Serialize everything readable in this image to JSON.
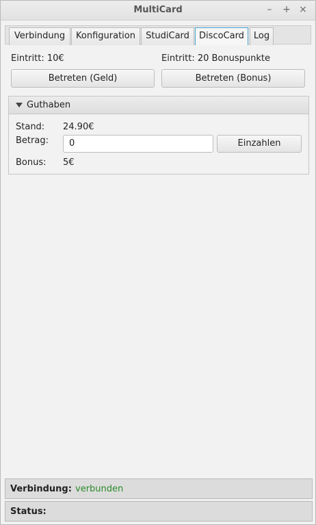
{
  "window": {
    "title": "MultiCard",
    "controls": {
      "minimize": "–",
      "maximize": "+",
      "close": "×"
    }
  },
  "tabs": [
    {
      "label": "Verbindung",
      "active": false
    },
    {
      "label": "Konfiguration",
      "active": false
    },
    {
      "label": "StudiCard",
      "active": false
    },
    {
      "label": "DiscoCard",
      "active": true
    },
    {
      "label": "Log",
      "active": false
    }
  ],
  "disco": {
    "entry_money_label": "Eintritt: 10€",
    "entry_bonus_label": "Eintritt: 20 Bonuspunkte",
    "enter_money_button": "Betreten (Geld)",
    "enter_bonus_button": "Betreten (Bonus)"
  },
  "balance_panel": {
    "title": "Guthaben",
    "stand_label": "Stand:",
    "stand_value": "24.90€",
    "betrag_label": "Betrag:",
    "betrag_value": "0",
    "deposit_button": "Einzahlen",
    "bonus_label": "Bonus:",
    "bonus_value": "5€"
  },
  "status": {
    "connection_label": "Verbindung:",
    "connection_value": "verbunden",
    "connection_color": "#2a8a2a",
    "status_label": "Status:",
    "status_value": ""
  }
}
